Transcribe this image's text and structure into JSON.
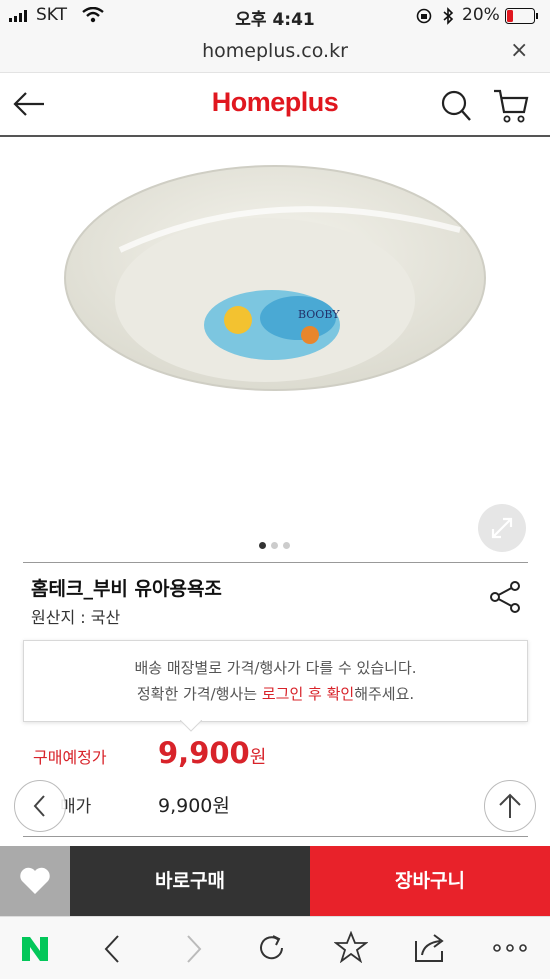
{
  "status": {
    "carrier": "SKT",
    "time": "오후 4:41",
    "battery": "20%"
  },
  "browser": {
    "url": "homeplus.co.kr",
    "close": "×"
  },
  "header": {
    "logo": "Homeplus"
  },
  "product": {
    "image_label": "BOOBY",
    "title": "홈테크_부비 유아용욕조",
    "origin": "원산지 : 국산"
  },
  "notice": {
    "line1": "배송 매장별로 가격/행사가 다를 수 있습니다.",
    "line2_prefix": "정확한 가격/행사는 ",
    "line2_highlight": "로그인 후 확인",
    "line2_suffix": "해주세요."
  },
  "price": {
    "expected_label": "구매예정가",
    "expected_value": "9,900",
    "unit": "원",
    "regular_label": "판매가",
    "regular_label_visible": "매가",
    "regular_value": "9,900원"
  },
  "actions": {
    "buy_now": "바로구매",
    "cart": "장바구니"
  },
  "carousel": {
    "count": 3,
    "active": 0
  },
  "colors": {
    "brand": "#e0171f",
    "price": "#d8232a",
    "cart": "#e8222a",
    "naver": "#03c75a"
  }
}
